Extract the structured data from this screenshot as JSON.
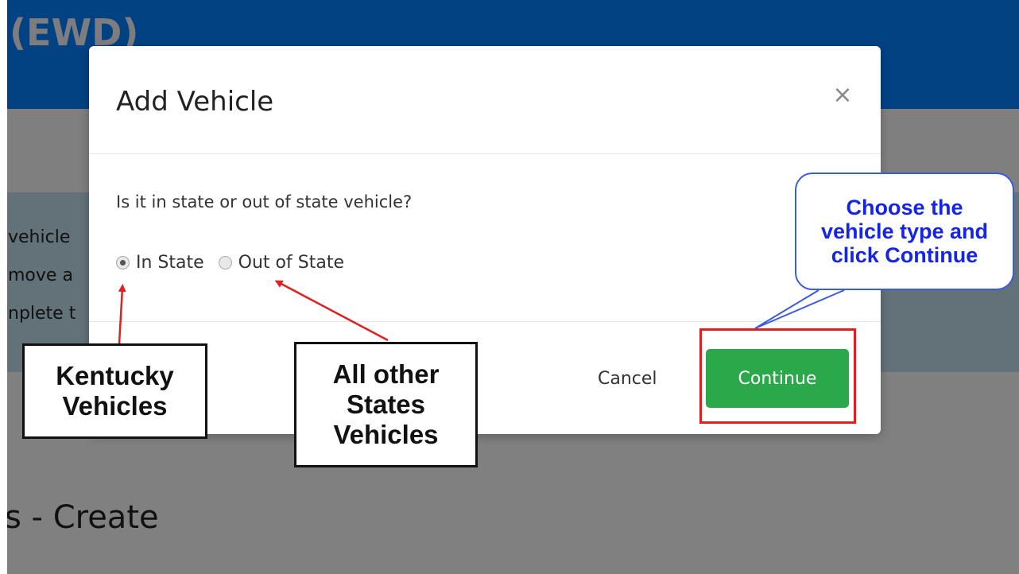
{
  "background": {
    "header_title": "(EWD)",
    "lines": [
      "vehicle",
      "move a",
      "nplete t"
    ],
    "page_title": "s - Create"
  },
  "modal": {
    "title": "Add Vehicle",
    "close_glyph": "×",
    "question": "Is it in state or out of state vehicle?",
    "options": [
      {
        "label": "In State",
        "checked": true
      },
      {
        "label": "Out of State",
        "checked": false
      }
    ],
    "cancel_label": "Cancel",
    "continue_label": "Continue"
  },
  "annotations": {
    "kentucky_label": [
      "Kentucky",
      "Vehicles"
    ],
    "other_label": [
      "All other",
      "States",
      "Vehicles"
    ],
    "callout": [
      "Choose the",
      "vehicle type and",
      "click Continue"
    ]
  },
  "colors": {
    "header": "#024283",
    "continue_button": "#2aa84a",
    "arrow": "#e02020",
    "callout_text": "#1525e8"
  },
  "icons": {
    "close": "close-icon",
    "radio_in_state": "radio-checked-icon",
    "radio_out_state": "radio-unchecked-icon"
  }
}
